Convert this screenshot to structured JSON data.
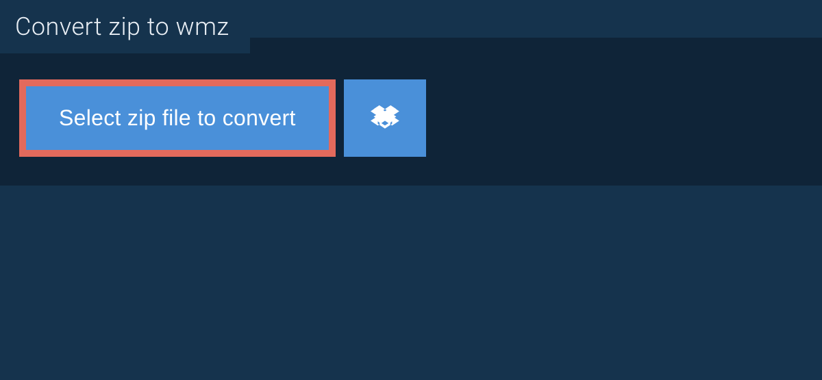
{
  "header": {
    "title": "Convert zip to wmz"
  },
  "actions": {
    "select_label": "Select zip file to convert"
  },
  "colors": {
    "page_bg": "#15334d",
    "panel_bg": "#0f2438",
    "button_bg": "#4a90d9",
    "highlight_border": "#e36a5c"
  }
}
